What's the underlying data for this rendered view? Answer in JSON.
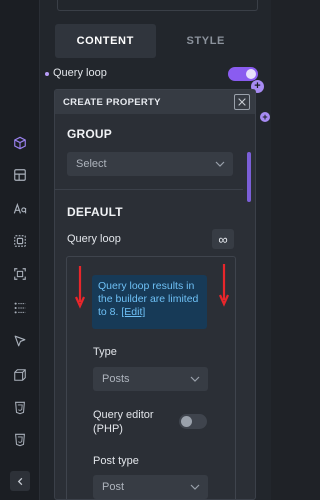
{
  "tabs": [
    {
      "label": "CONTENT",
      "active": true
    },
    {
      "label": "STYLE",
      "active": false
    }
  ],
  "background_row": {
    "label": "Query loop",
    "toggle_on": true
  },
  "modal": {
    "title": "CREATE PROPERTY",
    "group": {
      "heading": "GROUP",
      "select_value": "Select"
    },
    "default": {
      "heading": "DEFAULT",
      "query_loop_label": "Query loop",
      "loop_button_glyph": "∞",
      "info_text": "Query loop results in the builder are limited to 8.",
      "info_link": "[Edit]",
      "type_label": "Type",
      "type_value": "Posts",
      "query_editor_label": "Query editor (PHP)",
      "query_editor_on": false,
      "post_type_label": "Post type",
      "post_type_value": "Post"
    }
  },
  "rail_icons": [
    "box-icon",
    "layout-icon",
    "typography-icon",
    "frame-icon",
    "selection-icon",
    "grid-dots-icon",
    "cursor-icon",
    "cube-icon",
    "css3-icon",
    "css3-icon-2"
  ],
  "colors": {
    "accent": "#8a5cf0",
    "info_bg": "#173a57",
    "info_text": "#6ec0f5",
    "annotation_red": "#e8262b"
  }
}
